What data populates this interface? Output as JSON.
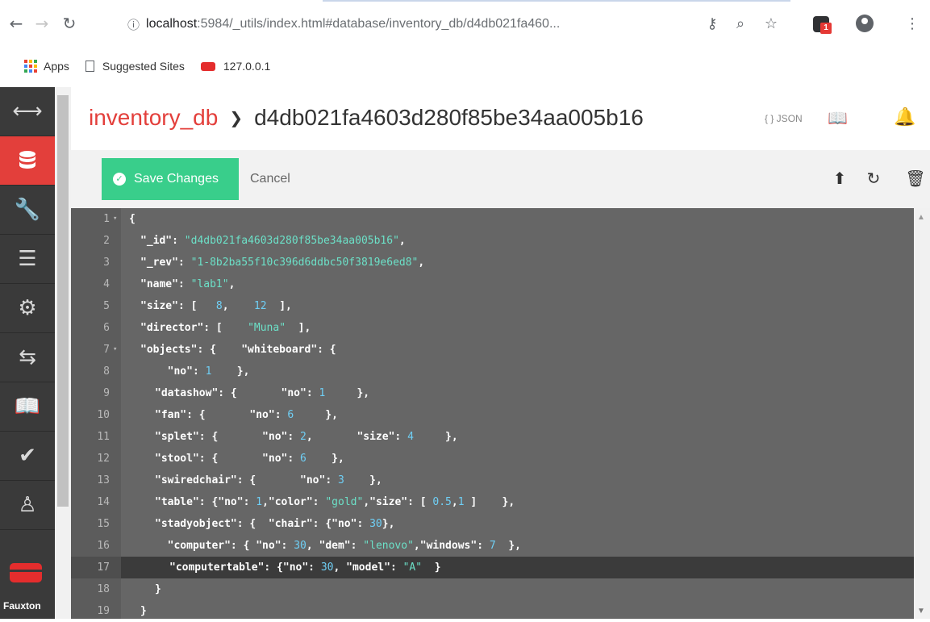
{
  "browser": {
    "url_host": "localhost",
    "url_path": ":5984/_utils/index.html#database/inventory_db/d4db021fa460...",
    "ext_badge": "1",
    "bookmarks": [
      {
        "label": "Apps"
      },
      {
        "label": "Suggested Sites"
      },
      {
        "label": "127.0.0.1"
      }
    ]
  },
  "sidebar": {
    "items": [
      {
        "icon": "arrows-icon",
        "glyph": "⟷"
      },
      {
        "icon": "database-icon",
        "glyph": "⛁"
      },
      {
        "icon": "wrench-icon",
        "glyph": "🔧"
      },
      {
        "icon": "server-icon",
        "glyph": "☰"
      },
      {
        "icon": "gear-icon",
        "glyph": "⚙"
      },
      {
        "icon": "replication-icon",
        "glyph": "⇆"
      },
      {
        "icon": "docs-book-icon",
        "glyph": "📖"
      },
      {
        "icon": "verify-check-icon",
        "glyph": "✔"
      },
      {
        "icon": "user-icon",
        "glyph": "♙"
      }
    ],
    "brand": "Fauxton"
  },
  "header": {
    "db_name": "inventory_db",
    "separator": "❯",
    "doc_id": "d4db021fa4603d280f85be34aa005b16",
    "json_link": "{ } JSON"
  },
  "toolbar": {
    "save_label": "Save Changes",
    "cancel_label": "Cancel"
  },
  "editor": {
    "highlight_line": 17,
    "lines": [
      {
        "n": "1",
        "fold": true
      },
      {
        "n": "2"
      },
      {
        "n": "3"
      },
      {
        "n": "4"
      },
      {
        "n": "5"
      },
      {
        "n": "6"
      },
      {
        "n": "7",
        "fold": true
      },
      {
        "n": "8"
      },
      {
        "n": "9"
      },
      {
        "n": "10"
      },
      {
        "n": "11"
      },
      {
        "n": "12"
      },
      {
        "n": "13"
      },
      {
        "n": "14"
      },
      {
        "n": "15"
      },
      {
        "n": "16"
      },
      {
        "n": "17"
      },
      {
        "n": "18"
      },
      {
        "n": "19"
      }
    ],
    "code": {
      "l1": "{",
      "l2k": "\"_id\": ",
      "l2v": "\"d4db021fa4603d280f85be34aa005b16\"",
      "l2e": ",",
      "l3k": "\"_rev\": ",
      "l3v": "\"1-8b2ba55f10c396d6ddbc50f3819e6ed8\"",
      "l3e": ",",
      "l4k": "\"name\": ",
      "l4v": "\"lab1\"",
      "l4e": ",",
      "l5k": "\"size\": [   ",
      "l5a": "8",
      "l5b": ",    ",
      "l5c": "12",
      "l5e": "  ],",
      "l6k": "\"director\": [    ",
      "l6v": "\"Muna\"",
      "l6e": "  ],",
      "l7": "\"objects\": {    \"whiteboard\": {",
      "l8k": "  \"no\": ",
      "l8v": "1",
      "l8e": "    },",
      "l9k": "\"datashow\": {       \"no\": ",
      "l9v": "1",
      "l9e": "     },",
      "l10k": "\"fan\": {       \"no\": ",
      "l10v": "6",
      "l10e": "     },",
      "l11k": "\"splet\": {       \"no\": ",
      "l11v": "2",
      "l11m": ",       \"size\": ",
      "l11w": "4",
      "l11e": "     },",
      "l12k": "\"stool\": {       \"no\": ",
      "l12v": "6",
      "l12e": "    },",
      "l13k": "\"swiredchair\": {       \"no\": ",
      "l13v": "3",
      "l13e": "    },",
      "l14k": "\"table\": {\"no\": ",
      "l14a": "1",
      "l14b": ",\"color\": ",
      "l14c": "\"gold\"",
      "l14d": ",\"size\": [ ",
      "l14f": "0.5",
      "l14g": ",",
      "l14h": "1",
      "l14e": " ]    },",
      "l15k": "\"stadyobject\": {  \"chair\": {\"no\": ",
      "l15v": "30",
      "l15e": "},",
      "l16k": "  \"computer\": { \"no\": ",
      "l16a": "30",
      "l16b": ", \"dem\": ",
      "l16c": "\"lenovo\"",
      "l16d": ",\"windows\": ",
      "l16f": "7",
      "l16e": "  },",
      "l17k": "\"computertable\": {\"no\": ",
      "l17a": "30",
      "l17b": ", \"model\": ",
      "l17c": "\"A\"",
      "l17e": "  }",
      "l18": "}",
      "l19": "}"
    }
  },
  "colors": {
    "accent": "#e33f3b",
    "save_green": "#39ce8b",
    "sidebar": "#3a3a3a",
    "editor_bg": "#666666"
  }
}
